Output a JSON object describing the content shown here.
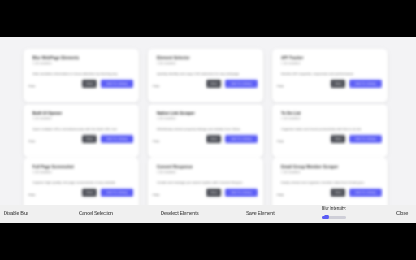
{
  "cards": [
    {
      "title": "Blur WebPage Elements",
      "users": "1.3k installed",
      "desc": "Hide sensitive information in focus attention by blurring any",
      "price": "Free",
      "view": "View",
      "add": "Add To Library"
    },
    {
      "title": "Element Selector",
      "users": "1.5k installed",
      "desc": "Quickly identify and copy CSS selectors for any webpage",
      "price": "Free",
      "view": "View",
      "add": "Add To Library"
    },
    {
      "title": "API Tracker",
      "users": "1.3k installed",
      "desc": "Monitor API requests, responses and performance",
      "price": "Free",
      "view": "View",
      "add": "Add To Library"
    },
    {
      "title": "Built UI Opener",
      "users": "1.3k installed",
      "desc": "Open multiple URLs simultaneously with the Bulk URL tool",
      "price": "Free",
      "view": "View",
      "add": "Add To Library"
    },
    {
      "title": "Native Link Scraper",
      "users": "1.3k installed",
      "desc": "Effortlessly extract property listings and details from Zillow",
      "price": "Free",
      "view": "View",
      "add": "Add To Library"
    },
    {
      "title": "To Do List",
      "users": "1.3k installed",
      "desc": "Organize tasks and boost productivity with this to do list",
      "price": "Free",
      "view": "View",
      "add": "Add To Library"
    },
    {
      "title": "Full Page Screenshot",
      "users": "1.3k installed",
      "desc": "Capture high quality, full page screenshots of any website",
      "price": "Free",
      "view": "View",
      "add": "Add To Library"
    },
    {
      "title": "Convert Response",
      "users": "1.3k installed",
      "desc": "Create and manage pre-saved replies with Canned Respon",
      "price": "Free",
      "view": "View",
      "add": "Add To Library"
    },
    {
      "title": "Email Group Member Scraper",
      "users": "1.3k installed",
      "desc": "Easily extract and organize member data from Email grou",
      "price": "Free",
      "view": "View",
      "add": "Add To Library"
    }
  ],
  "toolbar": {
    "disable_blur": "Disable Blur",
    "cancel_selection": "Cancel Selection",
    "deselect_elements": "Deselect Elements",
    "save_element": "Save Element",
    "blur_intensity_label": "Blur Intensity:",
    "blur_intensity_value": 0.2,
    "close": "Close"
  },
  "colors": {
    "accent": "#5b5df5",
    "view_button": "#4d4f57"
  }
}
